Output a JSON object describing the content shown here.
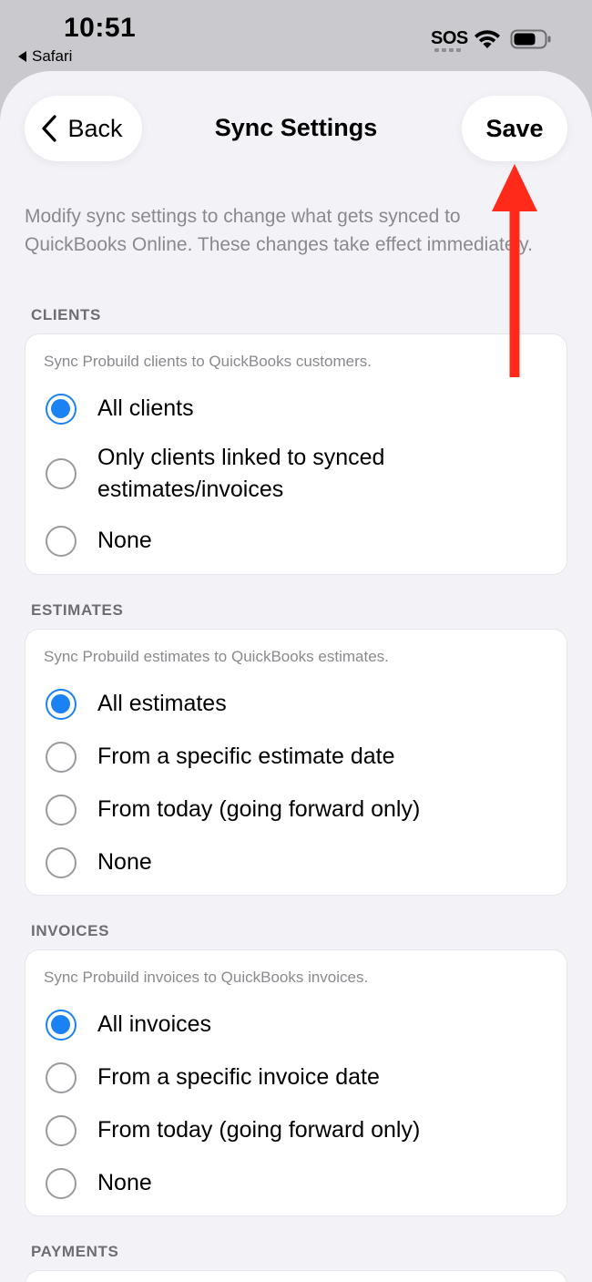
{
  "status_bar": {
    "time": "10:51",
    "back_app": "Safari",
    "sos": "SOS"
  },
  "nav": {
    "back_label": "Back",
    "title": "Sync Settings",
    "save_label": "Save"
  },
  "intro": "Modify sync settings to change what gets synced to QuickBooks Online. These changes take effect immediately.",
  "sections": {
    "clients": {
      "header": "CLIENTS",
      "description": "Sync Probuild clients to QuickBooks customers.",
      "options": [
        {
          "label": "All clients",
          "selected": true
        },
        {
          "label": "Only clients linked to synced estimates/invoices",
          "selected": false
        },
        {
          "label": "None",
          "selected": false
        }
      ]
    },
    "estimates": {
      "header": "ESTIMATES",
      "description": "Sync Probuild estimates to QuickBooks estimates.",
      "options": [
        {
          "label": "All estimates",
          "selected": true
        },
        {
          "label": "From a specific estimate date",
          "selected": false
        },
        {
          "label": "From today (going forward only)",
          "selected": false
        },
        {
          "label": "None",
          "selected": false
        }
      ]
    },
    "invoices": {
      "header": "INVOICES",
      "description": "Sync Probuild invoices to QuickBooks invoices.",
      "options": [
        {
          "label": "All invoices",
          "selected": true
        },
        {
          "label": "From a specific invoice date",
          "selected": false
        },
        {
          "label": "From today (going forward only)",
          "selected": false
        },
        {
          "label": "None",
          "selected": false
        }
      ]
    },
    "payments": {
      "header": "PAYMENTS"
    }
  },
  "colors": {
    "accent": "#1a82f2",
    "annotation_arrow": "#ff2a1a",
    "background": "#f2f2f7"
  }
}
